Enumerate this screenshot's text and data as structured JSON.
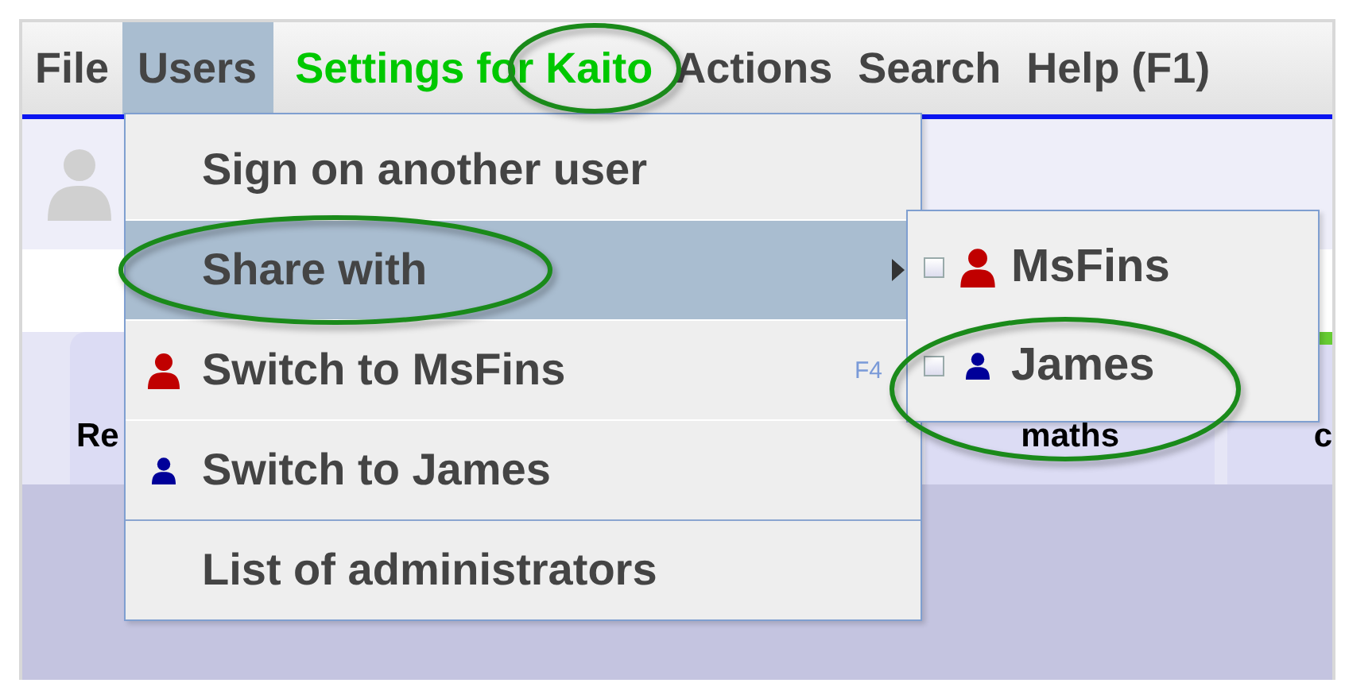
{
  "menu_bar": [
    {
      "label": "File",
      "kind": "menu",
      "selected": false
    },
    {
      "label": "Users",
      "kind": "menu",
      "selected": true
    },
    {
      "label": "Settings for Kaito",
      "kind": "settings",
      "selected": false
    },
    {
      "label": "Actions",
      "kind": "menu",
      "selected": false
    },
    {
      "label": "Search",
      "kind": "menu",
      "selected": false
    },
    {
      "label": "Help (F1)",
      "kind": "menu",
      "selected": false
    }
  ],
  "tabs": [
    {
      "label": "Re"
    },
    {
      "label": "maths"
    },
    {
      "label": "c"
    }
  ],
  "users_menu": [
    {
      "label": "Sign on another user",
      "selected": false
    },
    {
      "label": "Share with",
      "selected": true,
      "submenu": true
    },
    {
      "label": "Switch to MsFins",
      "selected": false,
      "color": "#c00000",
      "shortcut": "F4"
    },
    {
      "label": "Switch to James",
      "selected": false,
      "color": "#000099"
    },
    {
      "label": "List of administrators",
      "selected": false,
      "separator_before": true
    }
  ],
  "share_submenu": [
    {
      "label": "MsFins",
      "checked": false,
      "color": "#c00000"
    },
    {
      "label": "James",
      "checked": false,
      "color": "#000099"
    }
  ]
}
